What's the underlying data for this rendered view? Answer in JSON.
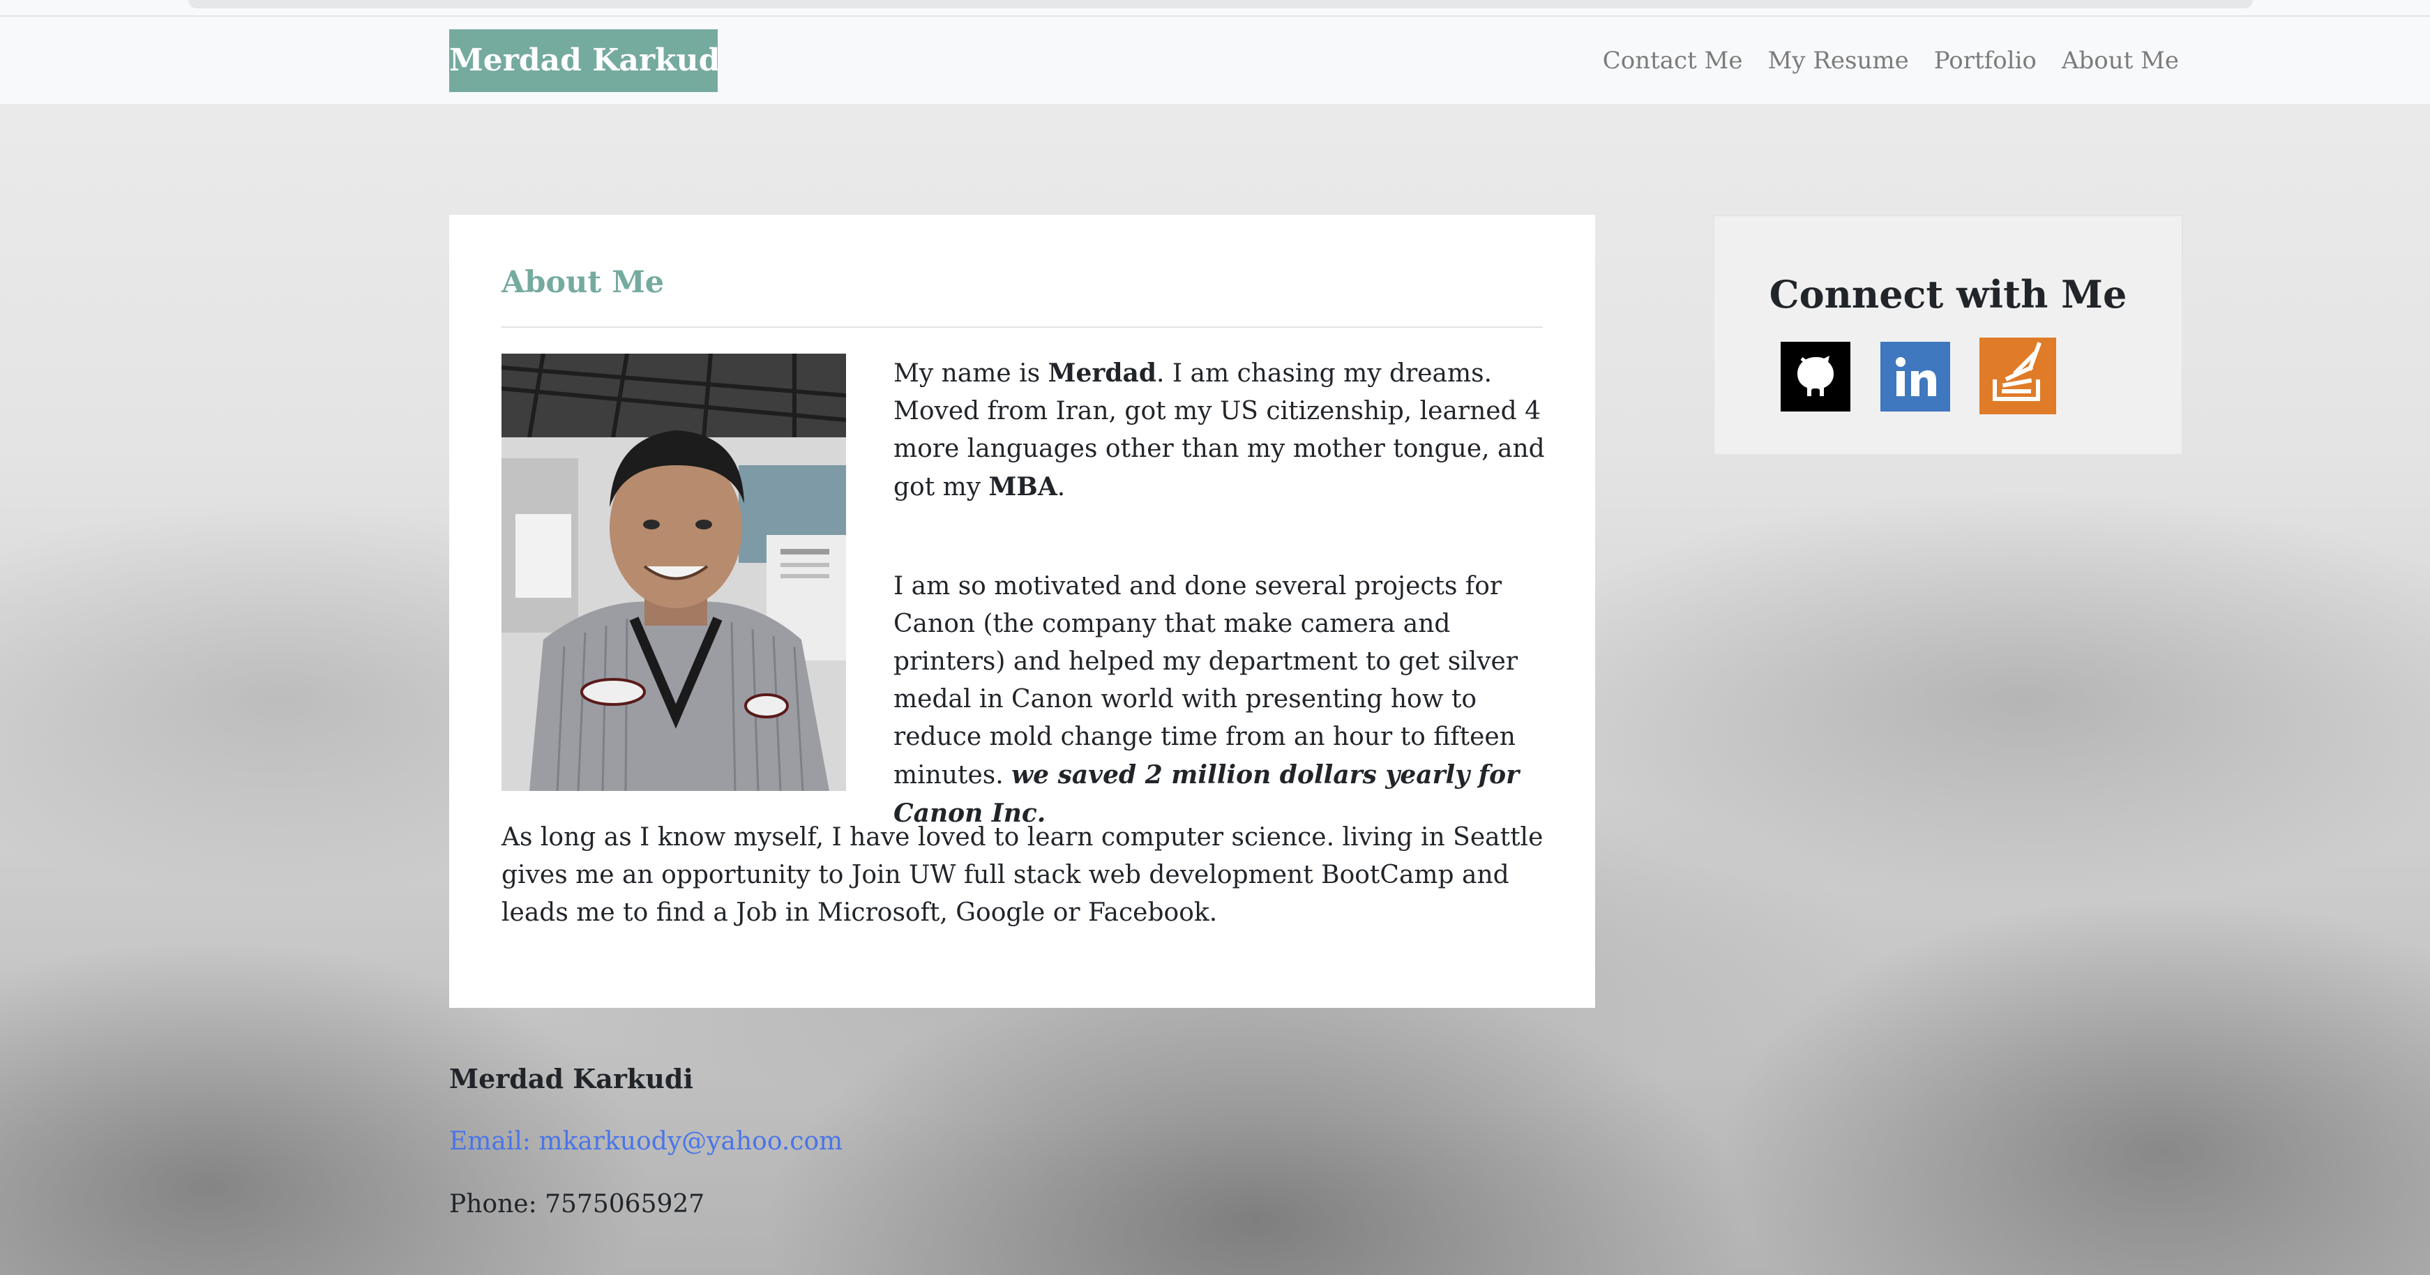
{
  "navbar": {
    "brand": "Merdad Karkudi",
    "links": [
      "Contact Me",
      "My Resume",
      "Portfolio",
      "About Me"
    ]
  },
  "about": {
    "title": "About Me",
    "para1": {
      "t1": "My name is ",
      "b1": "Merdad",
      "t2": ". I am chasing my dreams. Moved from Iran, got my US citizenship, learned 4 more languages other than my mother tongue, and got my ",
      "b2": "MBA",
      "t3": "."
    },
    "para2": {
      "t1": "I am so motivated and done several projects for Canon (the company that make camera and printers) and helped my department to get silver medal in Canon world with presenting how to reduce mold change time from an hour to fifteen minutes. ",
      "em": "we saved 2 million dollars yearly for Canon Inc."
    },
    "para3": "As long as I know myself, I have loved to learn computer science. living in Seattle gives me an opportunity to Join UW full stack web development BootCamp and leads me to find a Job in Microsoft, Google or Facebook."
  },
  "sidebar": {
    "title": "Connect with Me",
    "icons": [
      "github-icon",
      "linkedin-icon",
      "stackoverflow-icon"
    ],
    "colors": {
      "github": "#000000",
      "linkedin": "#3f78be",
      "stackoverflow": "#e07b27"
    }
  },
  "footer": {
    "name": "Merdad Karkudi",
    "email": "Email: mkarkuody@yahoo.com",
    "phone": "Phone: 7575065927"
  },
  "colors": {
    "accent": "#75aa9f",
    "link": "#4a75e8"
  }
}
